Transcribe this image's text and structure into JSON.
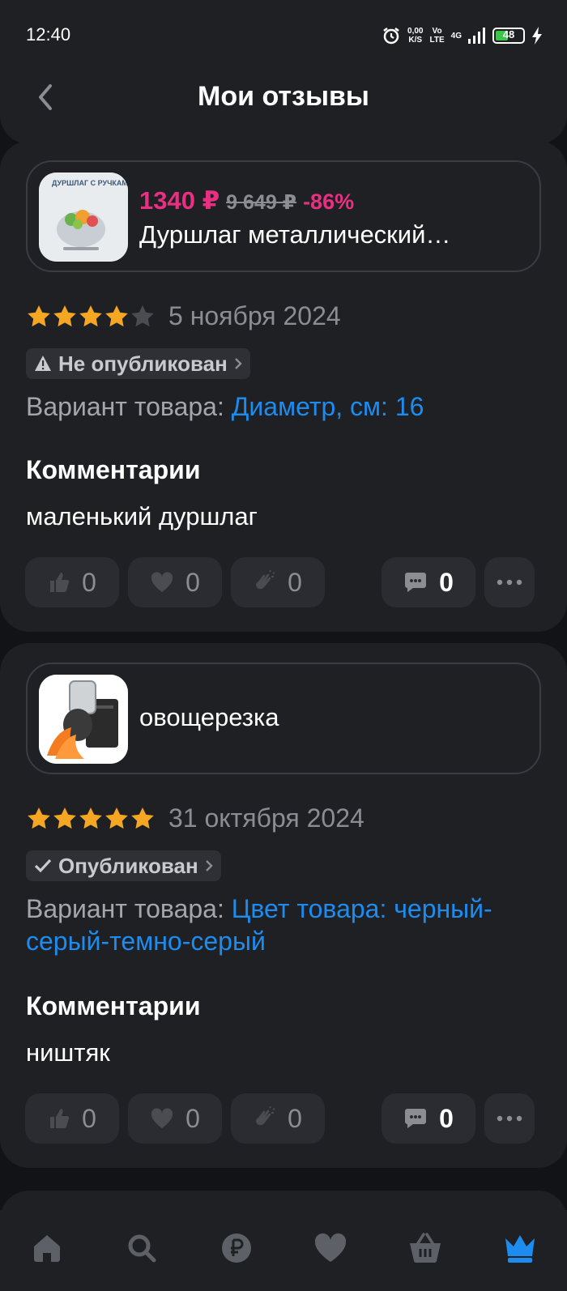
{
  "status_bar": {
    "time": "12:40",
    "net_speed_value": "0,00",
    "net_speed_unit": "K/S",
    "volte_top": "Vo",
    "volte_bottom": "LTE",
    "network": "4G",
    "battery": "48",
    "battery_level": 0.48
  },
  "header": {
    "title": "Мои отзывы",
    "back_icon": "chevron-left-icon"
  },
  "reviews": [
    {
      "product": {
        "price_new": "1340 ₽",
        "price_old": "9 649 ₽",
        "discount": "-86%",
        "name": "Дуршлаг металлический…",
        "image_caption": "ДУРШЛАГ С РУЧКАМИ"
      },
      "rating": 4,
      "date": "5 ноября 2024",
      "status": "Не опубликован",
      "status_icon": "warning-icon",
      "variant_label": "Вариант товара: ",
      "variant_value": "Диаметр, см: 16",
      "comments_heading": "Комментарии",
      "comment": "маленький дуршлаг",
      "reactions": {
        "like": "0",
        "heart": "0",
        "clap": "0",
        "comments": "0"
      }
    },
    {
      "product": {
        "name": "овощерезка"
      },
      "rating": 5,
      "date": "31 октября 2024",
      "status": "Опубликован",
      "status_icon": "check-icon",
      "variant_label": "Вариант товара: ",
      "variant_value": "Цвет товара: черный-серый-темно-серый",
      "comments_heading": "Комментарии",
      "comment": "ништяк",
      "reactions": {
        "like": "0",
        "heart": "0",
        "clap": "0",
        "comments": "0"
      }
    }
  ],
  "bottom_nav": {
    "items": [
      "home-icon",
      "search-icon",
      "ruble-icon",
      "heart-icon",
      "basket-icon",
      "crown-icon"
    ],
    "active": "crown-icon"
  },
  "colors": {
    "background": "#121316",
    "card": "#1e2024",
    "accent_pink": "#ea2f83",
    "link_blue": "#1d8cf0",
    "star": "#f5a623",
    "star_empty": "#4a4c52",
    "nav_active": "#1d8cf0"
  }
}
